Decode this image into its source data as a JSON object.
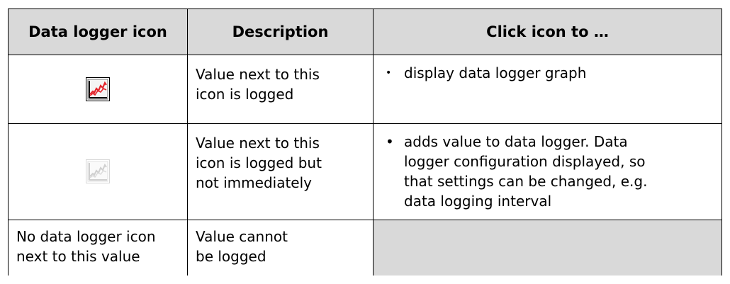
{
  "table": {
    "headers": [
      "Data logger icon",
      "Description",
      "Click icon to …"
    ],
    "rows": [
      {
        "icon": "data-logger-active-icon",
        "description": [
          "Value next to this",
          "icon is logged"
        ],
        "action_bullet": "•",
        "action_lines": [
          "display data logger graph"
        ]
      },
      {
        "icon": "data-logger-inactive-icon",
        "description": [
          "Value next to this",
          "icon is logged but",
          "not immediately"
        ],
        "action_bullet": "•",
        "action_lines": [
          "adds value to data logger. Data",
          "logger configuration displayed, so",
          "that settings can be changed, e.g.",
          "data logging interval"
        ]
      },
      {
        "icon_text": [
          "No data logger icon",
          "next to this value"
        ],
        "description": [
          "Value cannot",
          "be logged"
        ]
      }
    ]
  },
  "colors": {
    "header_bg": "#d9d9d9",
    "empty_cell_bg": "#d9d9d9",
    "active_graph_line": "#e3242b",
    "inactive_graph_line": "#cfcfcf"
  }
}
